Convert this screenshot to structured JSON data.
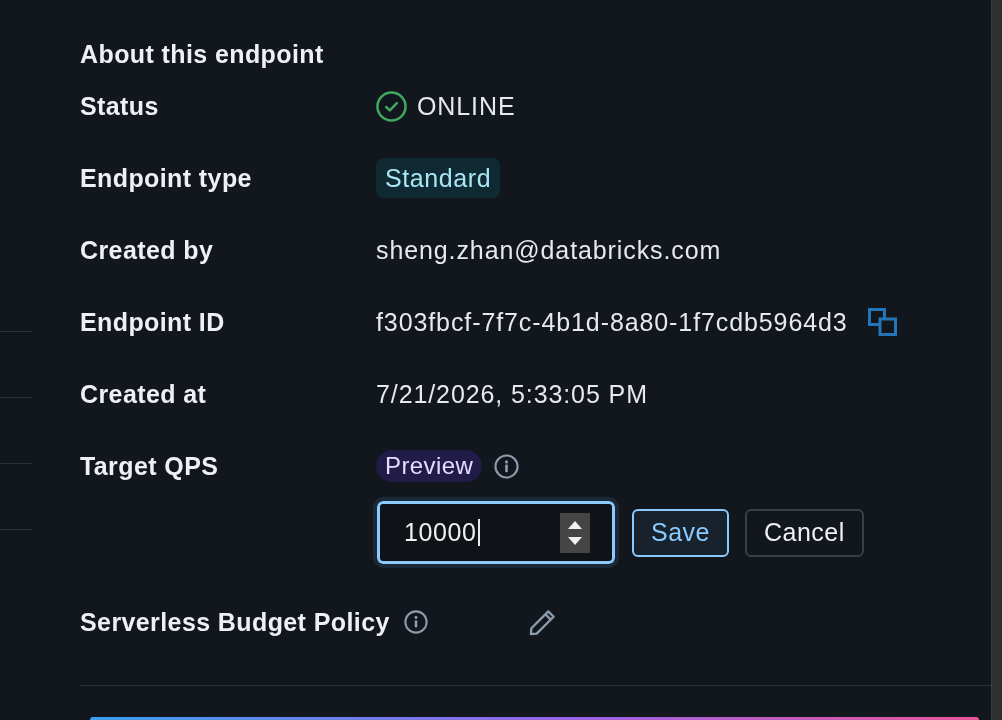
{
  "section": {
    "title": "About this endpoint"
  },
  "details": [
    {
      "kind": "status",
      "label": "Status",
      "value": "ONLINE"
    },
    {
      "kind": "tag",
      "label": "Endpoint type",
      "value": "Standard"
    },
    {
      "kind": "text",
      "label": "Created by",
      "value": "sheng.zhan@databricks.com"
    },
    {
      "kind": "copyable",
      "label": "Endpoint ID",
      "value": "f303fbcf-7f7c-4b1d-8a80-1f7cdb5964d3"
    },
    {
      "kind": "text",
      "label": "Created at",
      "value": "7/21/2026, 5:33:05 PM"
    },
    {
      "kind": "number_edit",
      "label": "Target QPS",
      "badge": "Preview",
      "value": "10000",
      "focused": true,
      "buttons": [
        {
          "label": "Save",
          "kind": "primary"
        },
        {
          "label": "Cancel",
          "kind": "secondary"
        }
      ]
    },
    {
      "kind": "policy",
      "label": "Serverless Budget Policy"
    }
  ]
}
